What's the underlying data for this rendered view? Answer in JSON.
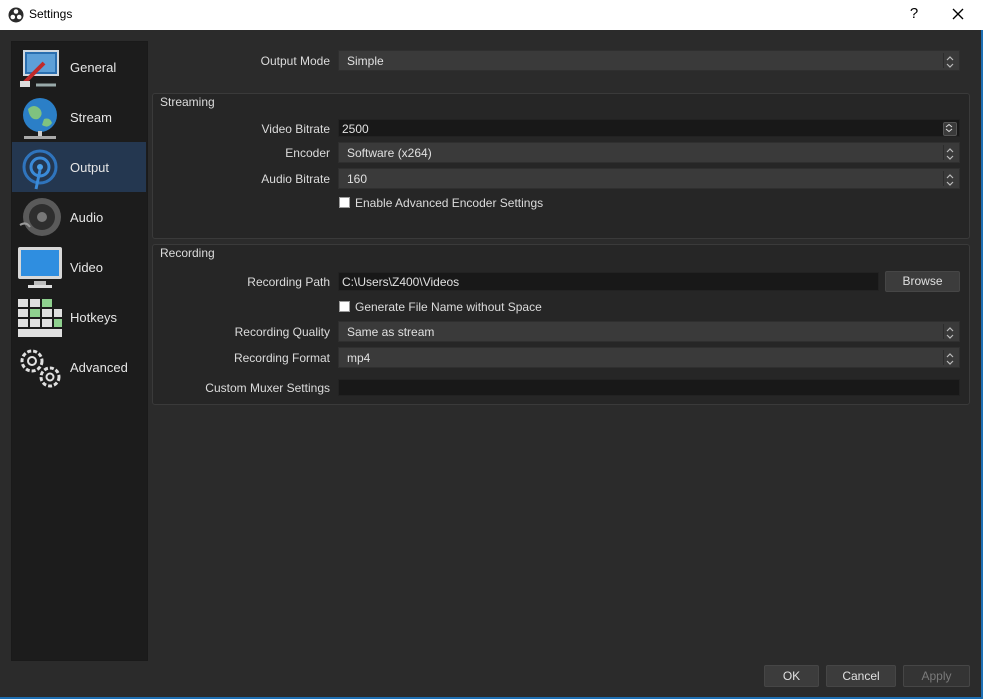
{
  "window": {
    "title": "Settings",
    "help": "?",
    "close_icon": "close-icon",
    "app_icon": "obs-logo-icon"
  },
  "sidebar": {
    "items": [
      {
        "label": "General",
        "icon": "general-icon"
      },
      {
        "label": "Stream",
        "icon": "stream-globe-icon"
      },
      {
        "label": "Output",
        "icon": "output-broadcast-icon",
        "active": true
      },
      {
        "label": "Audio",
        "icon": "speaker-icon"
      },
      {
        "label": "Video",
        "icon": "monitor-icon"
      },
      {
        "label": "Hotkeys",
        "icon": "keyboard-icon"
      },
      {
        "label": "Advanced",
        "icon": "gears-icon"
      }
    ]
  },
  "output": {
    "mode_label": "Output Mode",
    "mode_value": "Simple"
  },
  "streaming": {
    "title": "Streaming",
    "video_bitrate_label": "Video Bitrate",
    "video_bitrate_value": "2500",
    "encoder_label": "Encoder",
    "encoder_value": "Software (x264)",
    "audio_bitrate_label": "Audio Bitrate",
    "audio_bitrate_value": "160",
    "advanced_encoder_label": "Enable Advanced Encoder Settings",
    "advanced_encoder_checked": false
  },
  "recording": {
    "title": "Recording",
    "path_label": "Recording Path",
    "path_value": "C:\\Users\\Z400\\Videos",
    "browse_label": "Browse",
    "no_space_label": "Generate File Name without Space",
    "no_space_checked": false,
    "quality_label": "Recording Quality",
    "quality_value": "Same as stream",
    "format_label": "Recording Format",
    "format_value": "mp4",
    "muxer_label": "Custom Muxer Settings",
    "muxer_value": ""
  },
  "footer": {
    "ok": "OK",
    "cancel": "Cancel",
    "apply": "Apply"
  },
  "colors": {
    "accent": "#243750",
    "window_border": "#1d6fb3",
    "background": "#2b2b2b"
  }
}
